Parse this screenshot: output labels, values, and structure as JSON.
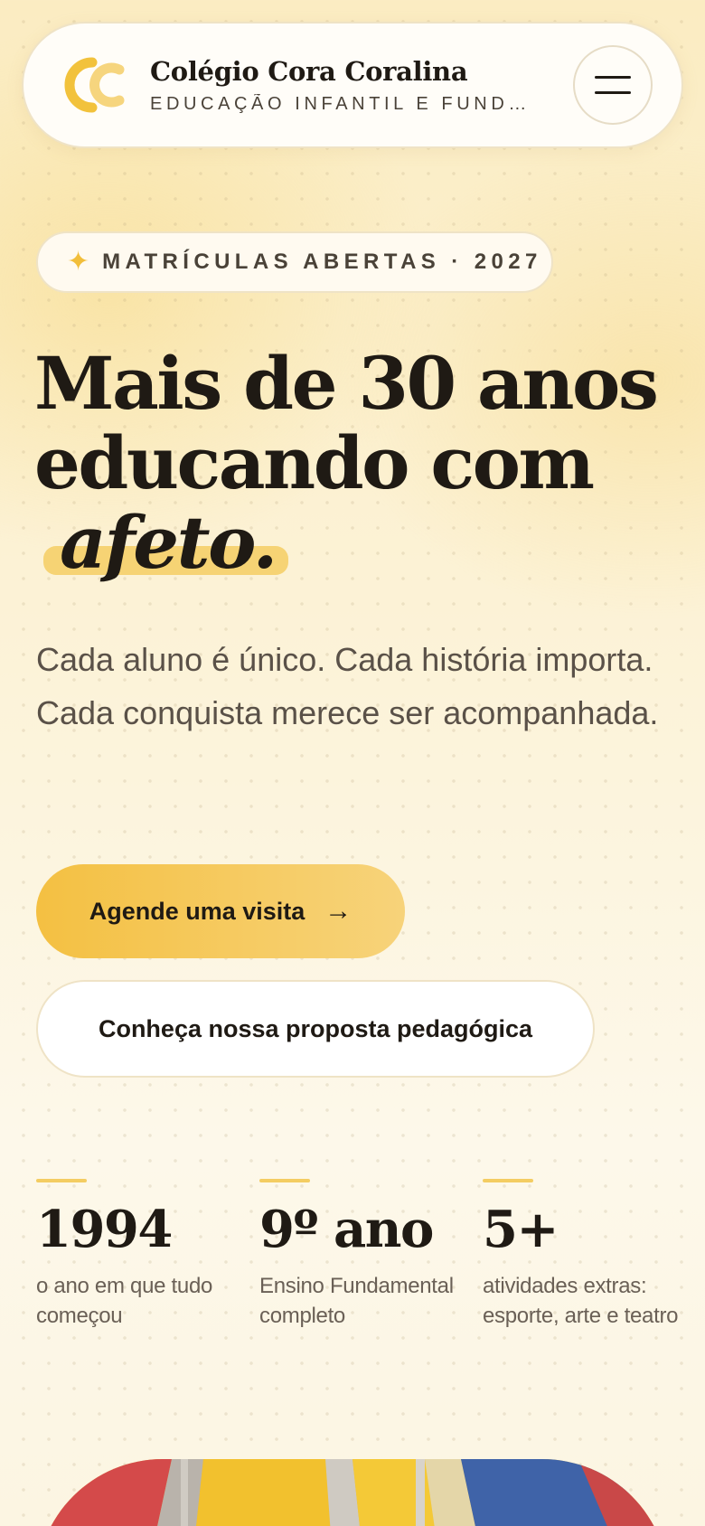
{
  "header": {
    "brand_name": "Colégio Cora Coralina",
    "brand_subtitle": "EDUCAÇÃO INFANTIL E FUNDA…",
    "logo_icon": "cc-monogram-logo",
    "menu_icon": "hamburger-menu-icon"
  },
  "hero": {
    "badge_icon": "sparkle-icon",
    "badge_text": "MATRÍCULAS ABERTAS · 2027",
    "headline_line1": "Mais de 30 anos",
    "headline_line2": "educando com",
    "headline_accent": "afeto.",
    "lede": "Cada aluno é único. Cada história importa. Cada conquista merece ser acompanhada.",
    "cta_primary": "Agende uma visita",
    "cta_primary_icon": "arrow-right-icon",
    "cta_secondary": "Conheça nossa proposta pedagógica"
  },
  "stats": [
    {
      "value": "1994",
      "label": "o ano em que tudo começou"
    },
    {
      "value": "9º ano",
      "label": "Ensino Fundamental completo"
    },
    {
      "value": "5+",
      "label": "atividades extras: esporte, arte e teatro"
    }
  ],
  "colors": {
    "accent": "#f4c042",
    "accent_highlight": "#f6d374",
    "text_dark": "#1f1a14",
    "text_muted": "#5a5148",
    "background": "#fcf3d9"
  }
}
